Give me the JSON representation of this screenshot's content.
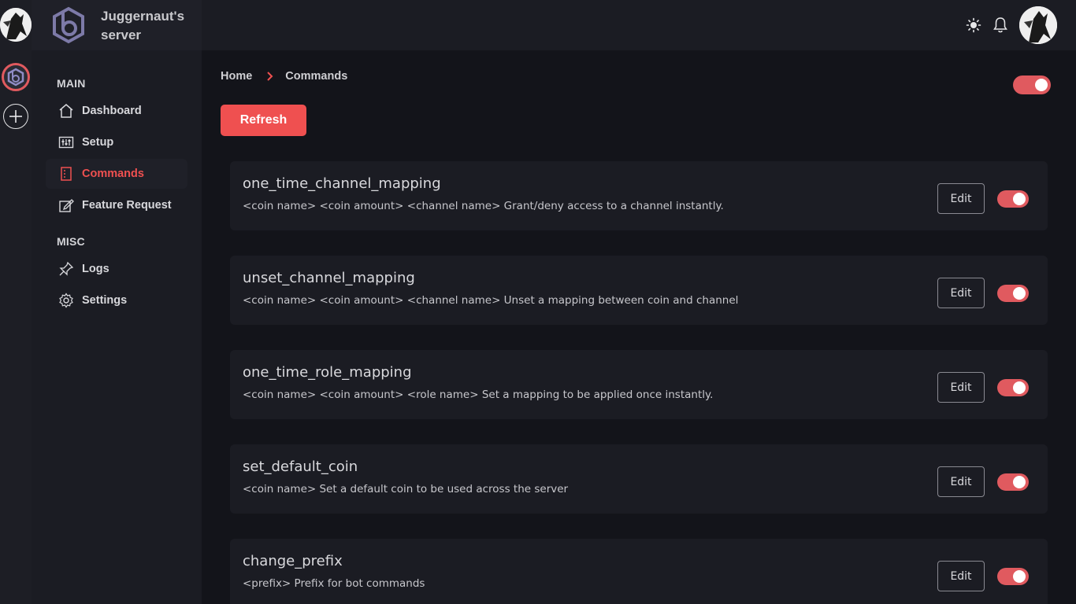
{
  "sidebar": {
    "server_name": "Juggernaut's server",
    "sections": [
      {
        "label": "MAIN",
        "items": [
          {
            "label": "Dashboard",
            "icon": "home-icon"
          },
          {
            "label": "Setup",
            "icon": "sliders-icon"
          },
          {
            "label": "Commands",
            "icon": "commands-icon",
            "active": true
          },
          {
            "label": "Feature Request",
            "icon": "edit-icon"
          }
        ]
      },
      {
        "label": "MISC",
        "items": [
          {
            "label": "Logs",
            "icon": "pin-icon"
          },
          {
            "label": "Settings",
            "icon": "gear-icon"
          }
        ]
      }
    ]
  },
  "topbar": {
    "icons": [
      "sun-icon",
      "bell-icon",
      "user-avatar"
    ]
  },
  "breadcrumb": {
    "home": "Home",
    "current": "Commands"
  },
  "actions": {
    "refresh_label": "Refresh",
    "global_toggle_on": true
  },
  "commands": [
    {
      "name": "one_time_channel_mapping",
      "description": "<coin name> <coin amount> <channel name> Grant/deny access to a channel instantly.",
      "edit_label": "Edit",
      "enabled": true
    },
    {
      "name": "unset_channel_mapping",
      "description": "<coin name> <coin amount> <channel name> Unset a mapping between coin and channel",
      "edit_label": "Edit",
      "enabled": true
    },
    {
      "name": "one_time_role_mapping",
      "description": "<coin name> <coin amount> <role name> Set a mapping to be applied once instantly.",
      "edit_label": "Edit",
      "enabled": true
    },
    {
      "name": "set_default_coin",
      "description": "<coin name> Set a default coin to be used across the server",
      "edit_label": "Edit",
      "enabled": true
    },
    {
      "name": "change_prefix",
      "description": "<prefix> Prefix for bot commands",
      "edit_label": "Edit",
      "enabled": true
    }
  ],
  "colors": {
    "accent": "#ef5050",
    "toggle_on": "#e05a5f",
    "background": "#13141a",
    "panel": "#1b1c23"
  }
}
